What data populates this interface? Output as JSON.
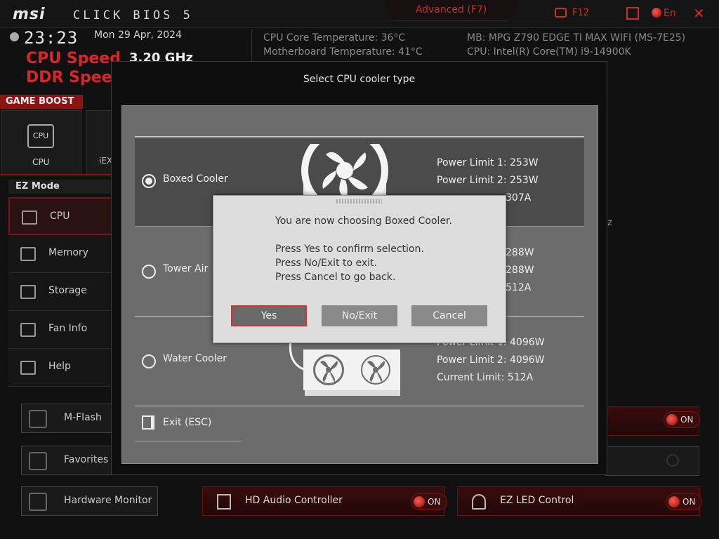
{
  "header": {
    "logo": "msi",
    "bios_name": "CLICK BIOS 5",
    "advanced_tab": "Advanced (F7)",
    "screenshot_key": "F12",
    "language": "En",
    "close_icon": "close-icon",
    "accent_color": "#c8302a"
  },
  "status": {
    "time": "23:23",
    "date": "Mon  29 Apr, 2024",
    "cpu_speed_label": "CPU Speed",
    "cpu_speed_value": "3.20 GHz",
    "ddr_speed_label": "DDR Speed",
    "cpu_core_temp": "CPU Core Temperature: 36°C",
    "mb_temp": "Motherboard Temperature: 41°C",
    "mb_model": "MB: MPG Z790 EDGE TI MAX WIFI (MS-7E25)",
    "cpu_model": "CPU: Intel(R) Core(TM) i9-14900K"
  },
  "game_boost": {
    "title": "GAME BOOST",
    "cpu_tile": "CPU",
    "cpu_icon_text": "CPU",
    "xmp_tile": "iEX"
  },
  "ez_mode": {
    "title": "EZ Mode",
    "items": [
      {
        "label": "CPU",
        "icon": "cpu-icon"
      },
      {
        "label": "Memory",
        "icon": "memory-icon"
      },
      {
        "label": "Storage",
        "icon": "storage-icon"
      },
      {
        "label": "Fan Info",
        "icon": "fan-icon"
      },
      {
        "label": "Help",
        "icon": "hotkey-icon"
      }
    ]
  },
  "bottom": {
    "mflash": "M-Flash",
    "favorites": "Favorites",
    "hw_monitor": "Hardware Monitor",
    "hd_audio": "HD Audio Controller",
    "ez_led": "EZ LED Control",
    "on_label": "ON"
  },
  "background_fragment": "z",
  "cooler_dialog": {
    "title": "Select CPU cooler type",
    "options": [
      {
        "label": "Boxed Cooler",
        "selected": true,
        "specs": [
          "Power Limit 1: 253W",
          "Power Limit 2: 253W",
          "307A"
        ]
      },
      {
        "label": "Tower Air",
        "selected": false,
        "specs": [
          "288W",
          "288W",
          "512A"
        ]
      },
      {
        "label": "Water Cooler",
        "selected": false,
        "specs": [
          "Power Limit 1: 4096W",
          "Power Limit 2: 4096W",
          "Current Limit: 512A"
        ]
      }
    ],
    "exit_label": "Exit (ESC)"
  },
  "confirm_dialog": {
    "line1": "You are now choosing Boxed Cooler.",
    "line2": "Press Yes to confirm selection.",
    "line3": "Press No/Exit to exit.",
    "line4": "Press Cancel to go back.",
    "yes": "Yes",
    "no_exit": "No/Exit",
    "cancel": "Cancel"
  }
}
